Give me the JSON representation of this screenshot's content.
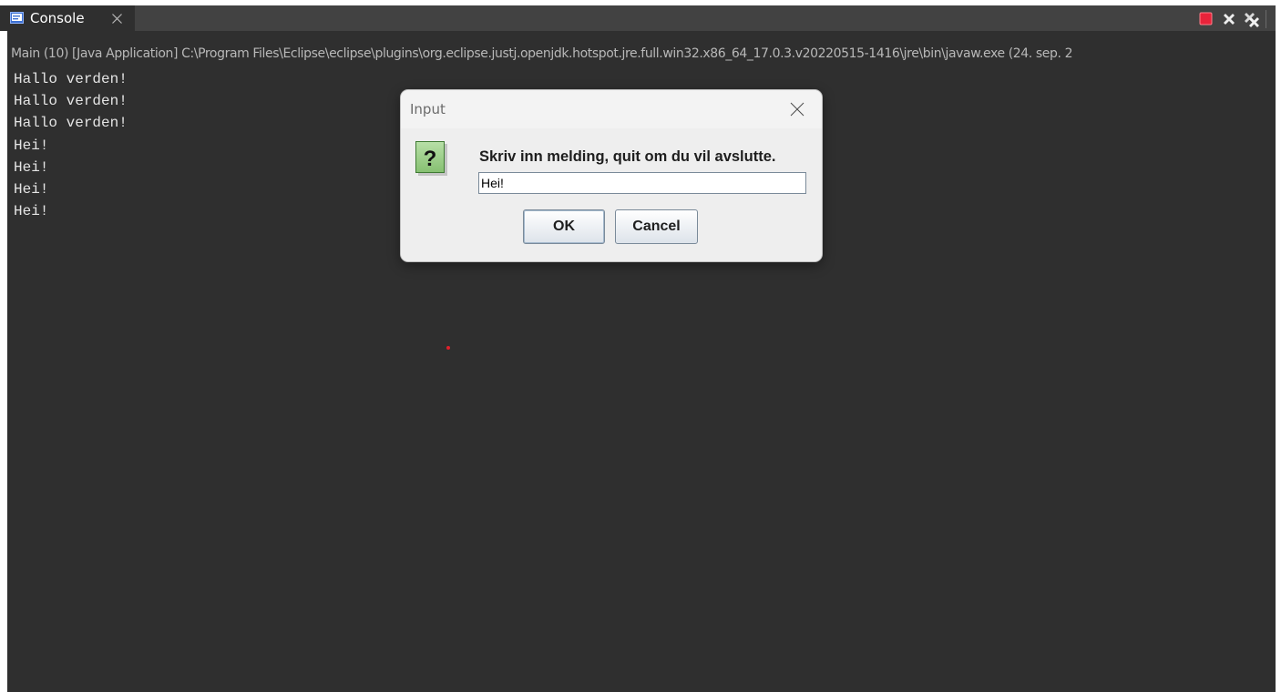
{
  "view": {
    "tab_label": "Console",
    "tab_icon": "console-icon",
    "toolbar_icons": [
      "terminate-icon",
      "remove-launch-icon",
      "remove-all-terminated-icon"
    ],
    "colors": {
      "tab_bar": "#424242",
      "console_background": "#2f2f2f",
      "console_text": "#e4e4e4",
      "terminate": "#e8233a"
    }
  },
  "console": {
    "launch_description": "Main (10) [Java Application] C:\\Program Files\\Eclipse\\eclipse\\plugins\\org.eclipse.justj.openjdk.hotspot.jre.full.win32.x86_64_17.0.3.v20220515-1416\\jre\\bin\\javaw.exe  (24. sep. 2",
    "output_lines": [
      "Hallo verden!",
      "Hallo verden!",
      "Hallo verden!",
      "Hei!",
      "Hei!",
      "Hei!",
      "Hei!"
    ]
  },
  "dialog": {
    "title": "Input",
    "icon": "question-icon",
    "prompt": "Skriv inn melding, quit om du vil avslutte.",
    "input_value": "Hei!",
    "ok_label": "OK",
    "cancel_label": "Cancel"
  }
}
